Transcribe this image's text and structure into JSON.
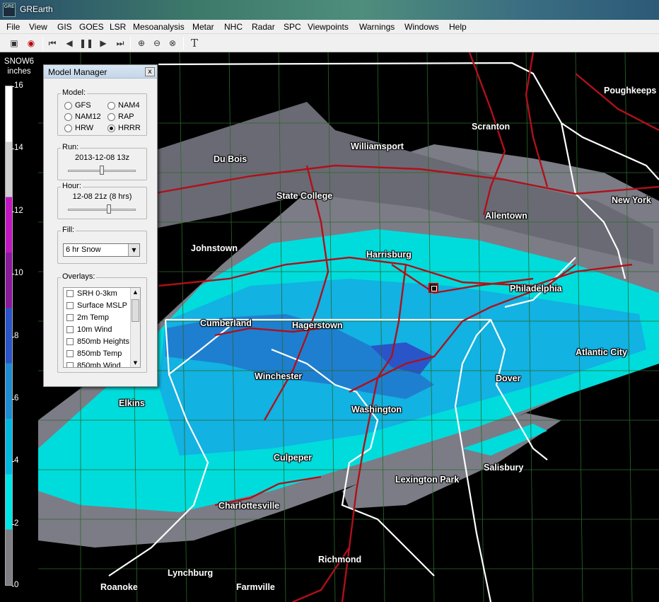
{
  "window": {
    "title": "GREarth",
    "app_icon_text": "GRE"
  },
  "menu": [
    "File",
    "View",
    "GIS",
    "GOES",
    "LSR",
    "Mesoanalysis",
    "Metar",
    "NHC",
    "Radar",
    "SPC",
    "Viewpoints",
    "Warnings",
    "Windows",
    "Help"
  ],
  "toolbar": {
    "icons": [
      "layers-icon",
      "radar-icon",
      "skip-back-icon",
      "step-back-icon",
      "pause-icon",
      "step-forward-icon",
      "skip-forward-icon",
      "zoom-in-icon",
      "zoom-out-icon",
      "zoom-reset-icon",
      "text-tool-icon"
    ],
    "text_tool_glyph": "T"
  },
  "legend": {
    "field": "SNOW6",
    "units": "inches",
    "ticks": [
      "16",
      "14",
      "12",
      "10",
      "8",
      "6",
      "4",
      "2",
      "0"
    ],
    "colors": [
      "#7f7f85",
      "#00e6e6",
      "#00b8e0",
      "#1e8cd2",
      "#2a55c8",
      "#8a1a9a",
      "#c018c0",
      "#cfcfcf",
      "#ffffff"
    ]
  },
  "model_manager": {
    "title": "Model Manager",
    "close": "x",
    "model_label": "Model:",
    "models": [
      {
        "name": "GFS",
        "selected": false
      },
      {
        "name": "NAM4",
        "selected": false
      },
      {
        "name": "NAM12",
        "selected": false
      },
      {
        "name": "RAP",
        "selected": false
      },
      {
        "name": "HRW",
        "selected": false
      },
      {
        "name": "HRRR",
        "selected": true
      }
    ],
    "run_label": "Run:",
    "run_value": "2013-12-08 13z",
    "run_slider_fraction": 0.5,
    "hour_label": "Hour:",
    "hour_value": "12-08 21z (8 hrs)",
    "hour_slider_fraction": 0.6,
    "fill_label": "Fill:",
    "fill_value": "6 hr Snow",
    "overlays_label": "Overlays:",
    "overlays": [
      "SRH 0-3km",
      "Surface MSLP",
      "2m Temp",
      "10m Wind",
      "850mb Heights",
      "850mb Temp",
      "850mb Wind"
    ]
  },
  "cities": [
    {
      "name": "Poughkeepsie",
      "text": "Poughkeeps"
    },
    {
      "name": "Scranton",
      "text": "Scranton"
    },
    {
      "name": "Williamsport",
      "text": "Williamsport"
    },
    {
      "name": "Du Bois",
      "text": "Du Bois"
    },
    {
      "name": "State College",
      "text": "State College"
    },
    {
      "name": "Allentown",
      "text": "Allentown"
    },
    {
      "name": "New York",
      "text": "New York"
    },
    {
      "name": "Johnstown",
      "text": "Johnstown"
    },
    {
      "name": "Harrisburg",
      "text": "Harrisburg"
    },
    {
      "name": "Philadelphia",
      "text": "Philadelphia"
    },
    {
      "name": "Cumberland",
      "text": "Cumberland"
    },
    {
      "name": "Hagerstown",
      "text": "Hagerstown"
    },
    {
      "name": "Atlantic City",
      "text": "Atlantic City"
    },
    {
      "name": "Winchester",
      "text": "Winchester"
    },
    {
      "name": "Dover",
      "text": "Dover"
    },
    {
      "name": "Elkins",
      "text": "Elkins"
    },
    {
      "name": "Washington",
      "text": "Washington"
    },
    {
      "name": "Culpeper",
      "text": "Culpeper"
    },
    {
      "name": "Salisbury",
      "text": "Salisbury"
    },
    {
      "name": "Lexington Park",
      "text": "Lexington Park"
    },
    {
      "name": "Charlottesville",
      "text": "Charlottesville"
    },
    {
      "name": "Richmond",
      "text": "Richmond"
    },
    {
      "name": "Lynchburg",
      "text": "Lynchburg"
    },
    {
      "name": "Roanoke",
      "text": "Roanoke"
    },
    {
      "name": "Farmville",
      "text": "Farmville"
    }
  ]
}
